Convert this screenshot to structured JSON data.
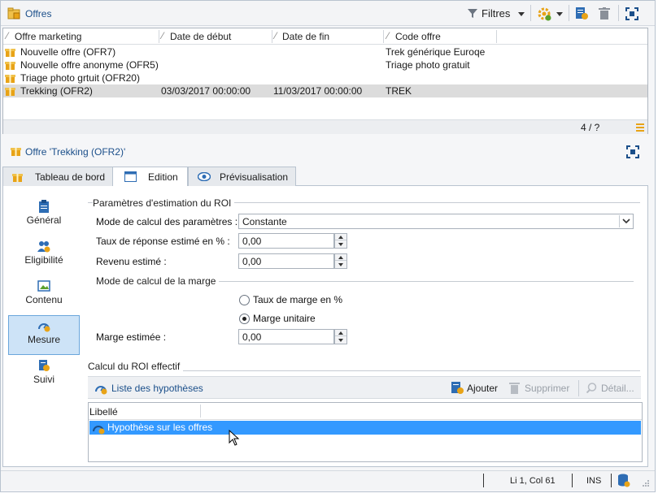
{
  "panel_title": "Offres",
  "toolbar": {
    "filters_label": "Filtres"
  },
  "list": {
    "columns": [
      "Offre marketing",
      "Date de début",
      "Date de fin",
      "Code offre"
    ],
    "rows": [
      {
        "name": "Nouvelle offre (OFR7)",
        "start": "",
        "end": "",
        "code": "Trek générique Euroqe"
      },
      {
        "name": "Nouvelle offre anonyme (OFR5)",
        "start": "",
        "end": "",
        "code": "Triage photo gratuit"
      },
      {
        "name": "Triage photo grtuit (OFR20)",
        "start": "",
        "end": "",
        "code": ""
      },
      {
        "name": "Trekking (OFR2)",
        "start": "03/03/2017 00:00:00",
        "end": "11/03/2017 00:00:00",
        "code": "TREK"
      }
    ],
    "selected_index": 3,
    "pager": "4 / ?"
  },
  "detail": {
    "title": "Offre 'Trekking (OFR2)'",
    "tabs": [
      "Tableau de bord",
      "Edition",
      "Prévisualisation"
    ],
    "active_tab": "Edition"
  },
  "sidebar": {
    "items": [
      {
        "label": "Général",
        "icon": "clipboard-icon"
      },
      {
        "label": "Eligibilité",
        "icon": "users-icon"
      },
      {
        "label": "Contenu",
        "icon": "image-icon"
      },
      {
        "label": "Mesure",
        "icon": "gauge-icon"
      },
      {
        "label": "Suivi",
        "icon": "tracking-icon"
      }
    ],
    "active": "Mesure"
  },
  "roi_estimation": {
    "group_title": "Paramètres d'estimation du ROI",
    "mode_label": "Mode de calcul des paramètres :",
    "mode_value": "Constante",
    "response_rate_label": "Taux de réponse estimé en % :",
    "response_rate_value": "0,00",
    "revenue_label": "Revenu estimé :",
    "revenue_value": "0,00",
    "margin_group_title": "Mode de calcul de la marge",
    "margin_options": [
      "Taux de marge en %",
      "Marge unitaire"
    ],
    "margin_selected": "Marge unitaire",
    "margin_estimate_label": "Marge estimée :",
    "margin_estimate_value": "0,00"
  },
  "roi_actual": {
    "group_title": "Calcul du ROI effectif",
    "hypotheses_link": "Liste des hypothèses",
    "add_label": "Ajouter",
    "delete_label": "Supprimer",
    "detail_label": "Détail...",
    "column_header": "Libellé",
    "items": [
      "Hypothèse sur les offres"
    ]
  },
  "status": {
    "position": "Li 1, Col 61",
    "mode": "INS"
  },
  "colors": {
    "accent": "#1b4f8a",
    "selection": "#3399ff",
    "sidebar_active": "#cde3f7",
    "gift": "#e8a317"
  }
}
